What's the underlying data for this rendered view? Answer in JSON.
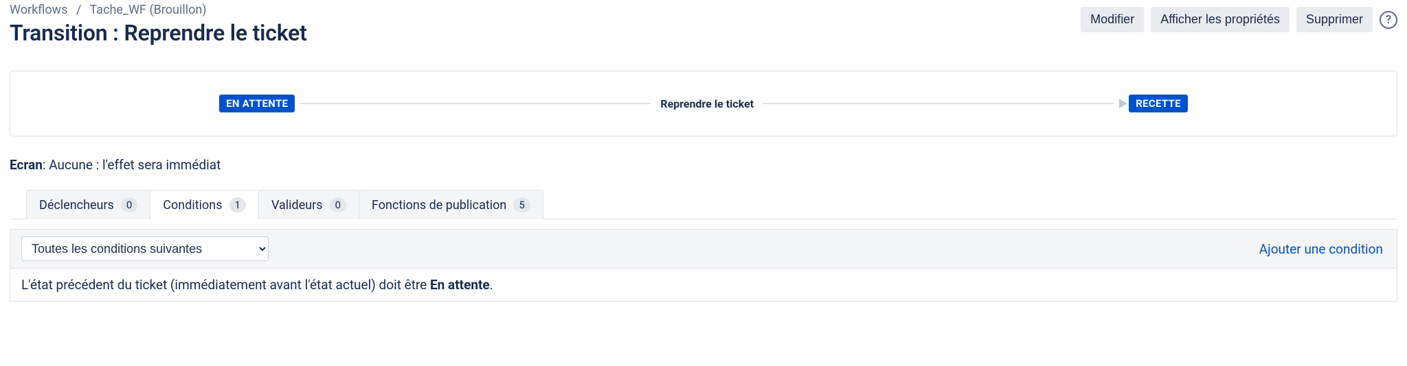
{
  "breadcrumb": {
    "root": "Workflows",
    "current": "Tache_WF (Brouillon)"
  },
  "page_title": "Transition : Reprendre le ticket",
  "actions": {
    "edit": "Modifier",
    "properties": "Afficher les propriétés",
    "delete": "Supprimer"
  },
  "transition": {
    "from_state": "EN ATTENTE",
    "name": "Reprendre le ticket",
    "to_state": "RECETTE"
  },
  "screen": {
    "label": "Ecran",
    "value": ": Aucune : l'effet sera immédiat"
  },
  "tabs": {
    "triggers": {
      "label": "Déclencheurs",
      "count": "0"
    },
    "conditions": {
      "label": "Conditions",
      "count": "1"
    },
    "validators": {
      "label": "Valideurs",
      "count": "0"
    },
    "postfunctions": {
      "label": "Fonctions de publication",
      "count": "5"
    }
  },
  "conditions_panel": {
    "select_value": "Toutes les conditions suivantes",
    "add_link": "Ajouter une condition",
    "rule_prefix": "L'état précédent du ticket (immédiatement avant l'état actuel) doit être ",
    "rule_strong": "En attente",
    "rule_suffix": "."
  }
}
